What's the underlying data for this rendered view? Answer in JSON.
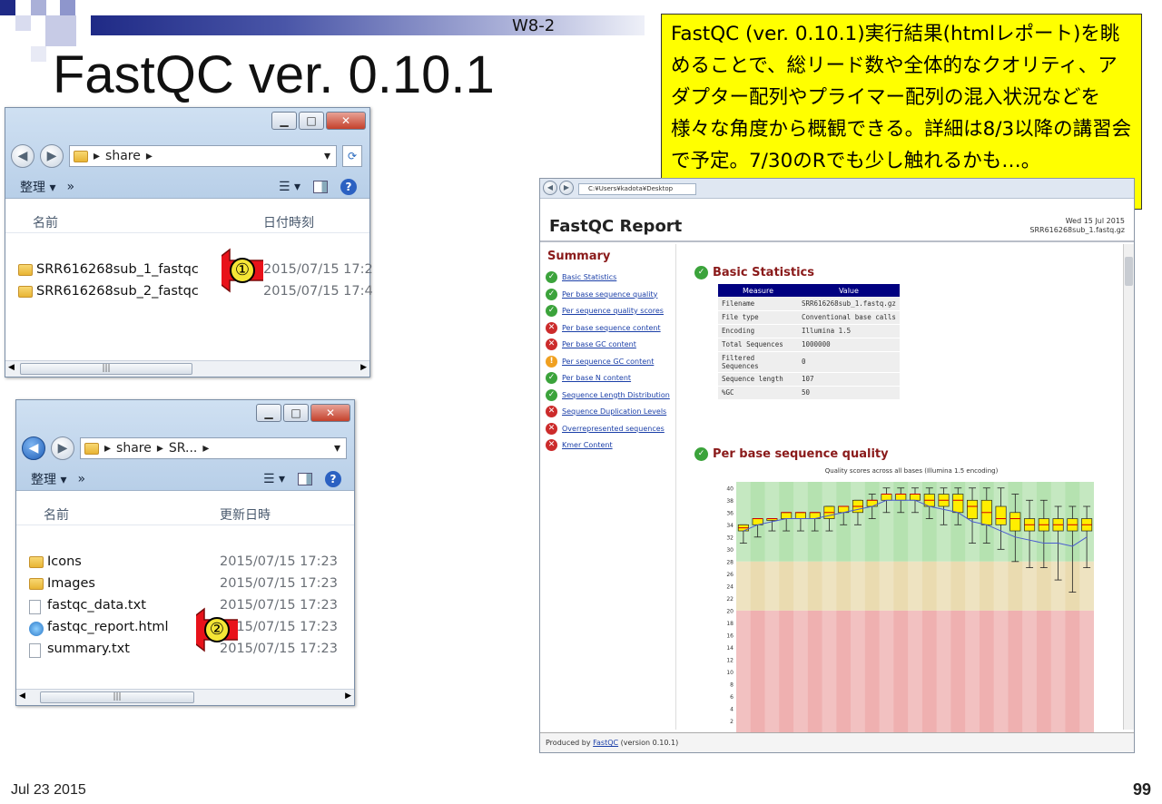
{
  "slide": {
    "code": "W8-2",
    "title": "FastQC ver. 0.10.1",
    "callout": "FastQC (ver. 0.10.1)実行結果(htmlレポート)を眺めることで、総リード数や全体的なクオリティ、アダプター配列やプライマー配列の混入状況などを様々な角度から概観できる。詳細は8/3以降の講習会で予定。7/30のRでも少し触れるかも…。",
    "date": "Jul 23 2015",
    "page": "99"
  },
  "explorer1": {
    "path": [
      "share"
    ],
    "organize_label": "整理 ▾",
    "more_label": "»",
    "col_name": "名前",
    "col_date": "日付時刻",
    "items": [
      {
        "name": "SRR616268sub_1_fastqc",
        "date": "2015/07/15 17:2",
        "icon": "folder-icon"
      },
      {
        "name": "SRR616268sub_2_fastqc",
        "date": "2015/07/15 17:4",
        "icon": "folder-icon"
      }
    ],
    "marker": "①"
  },
  "explorer2": {
    "path": [
      "share",
      "SR..."
    ],
    "organize_label": "整理 ▾",
    "more_label": "»",
    "col_name": "名前",
    "col_date": "更新日時",
    "items": [
      {
        "name": "Icons",
        "date": "2015/07/15 17:23",
        "icon": "folder-icon"
      },
      {
        "name": "Images",
        "date": "2015/07/15 17:23",
        "icon": "folder-icon"
      },
      {
        "name": "fastqc_data.txt",
        "date": "2015/07/15 17:23",
        "icon": "text-file-icon"
      },
      {
        "name": "fastqc_report.html",
        "date": "2015/07/15 17:23",
        "icon": "html-file-icon"
      },
      {
        "name": "summary.txt",
        "date": "2015/07/15 17:23",
        "icon": "text-file-icon"
      }
    ],
    "marker": "②"
  },
  "fastqc": {
    "url": "C:¥Users¥kadota¥Desktop",
    "report_title": "FastQC Report",
    "report_date": "Wed 15 Jul 2015",
    "report_file": "SRR616268sub_1.fastq.gz",
    "summary_heading": "Summary",
    "modules": [
      {
        "label": "Basic Statistics",
        "status": "pass"
      },
      {
        "label": "Per base sequence quality",
        "status": "pass"
      },
      {
        "label": "Per sequence quality scores",
        "status": "pass"
      },
      {
        "label": "Per base sequence content",
        "status": "fail"
      },
      {
        "label": "Per base GC content",
        "status": "fail"
      },
      {
        "label": "Per sequence GC content",
        "status": "warn"
      },
      {
        "label": "Per base N content",
        "status": "pass"
      },
      {
        "label": "Sequence Length Distribution",
        "status": "pass"
      },
      {
        "label": "Sequence Duplication Levels",
        "status": "fail"
      },
      {
        "label": "Overrepresented sequences",
        "status": "fail"
      },
      {
        "label": "Kmer Content",
        "status": "fail"
      }
    ],
    "basic_stats_heading": "Basic Statistics",
    "stats_header": [
      "Measure",
      "Value"
    ],
    "stats": [
      [
        "Filename",
        "SRR616268sub_1.fastq.gz"
      ],
      [
        "File type",
        "Conventional base calls"
      ],
      [
        "Encoding",
        "Illumina 1.5"
      ],
      [
        "Total Sequences",
        "1000000"
      ],
      [
        "Filtered Sequences",
        "0"
      ],
      [
        "Sequence length",
        "107"
      ],
      [
        "%GC",
        "50"
      ]
    ],
    "pbsq_heading": "Per base sequence quality",
    "plot_title": "Quality scores across all bases (Illumina 1.5 encoding)",
    "footer_prefix": "Produced by ",
    "footer_link": "FastQC",
    "footer_suffix": " (version 0.10.1)"
  },
  "chart_data": {
    "type": "box",
    "title": "Quality scores across all bases (Illumina 1.5 encoding)",
    "y_ticks": [
      2,
      4,
      6,
      8,
      10,
      12,
      14,
      16,
      18,
      20,
      22,
      24,
      26,
      28,
      30,
      32,
      34,
      36,
      38,
      40
    ],
    "ylim": [
      0,
      41
    ],
    "bands": {
      "good": [
        28,
        41
      ],
      "reasonable": [
        20,
        28
      ],
      "poor": [
        0,
        20
      ]
    },
    "boxes": [
      {
        "q1": 33,
        "q3": 34,
        "median": 33.5,
        "low": 31,
        "high": 34
      },
      {
        "q1": 34,
        "q3": 35,
        "median": 35,
        "low": 32,
        "high": 35
      },
      {
        "q1": 35,
        "q3": 35,
        "median": 35,
        "low": 33,
        "high": 35
      },
      {
        "q1": 35,
        "q3": 36,
        "median": 36,
        "low": 33,
        "high": 36
      },
      {
        "q1": 35,
        "q3": 36,
        "median": 36,
        "low": 33,
        "high": 36
      },
      {
        "q1": 35,
        "q3": 36,
        "median": 36,
        "low": 33,
        "high": 36
      },
      {
        "q1": 35,
        "q3": 37,
        "median": 36,
        "low": 33,
        "high": 37
      },
      {
        "q1": 36,
        "q3": 37,
        "median": 37,
        "low": 34,
        "high": 37
      },
      {
        "q1": 36,
        "q3": 38,
        "median": 37,
        "low": 34,
        "high": 38
      },
      {
        "q1": 37,
        "q3": 38,
        "median": 38,
        "low": 35,
        "high": 39
      },
      {
        "q1": 38,
        "q3": 39,
        "median": 39,
        "low": 36,
        "high": 40
      },
      {
        "q1": 38,
        "q3": 39,
        "median": 39,
        "low": 36,
        "high": 40
      },
      {
        "q1": 38,
        "q3": 39,
        "median": 39,
        "low": 36,
        "high": 40
      },
      {
        "q1": 37,
        "q3": 39,
        "median": 38,
        "low": 35,
        "high": 40
      },
      {
        "q1": 37,
        "q3": 39,
        "median": 38,
        "low": 34,
        "high": 40
      },
      {
        "q1": 36,
        "q3": 39,
        "median": 38,
        "low": 34,
        "high": 40
      },
      {
        "q1": 35,
        "q3": 38,
        "median": 37,
        "low": 31,
        "high": 40
      },
      {
        "q1": 34,
        "q3": 38,
        "median": 36,
        "low": 31,
        "high": 40
      },
      {
        "q1": 34,
        "q3": 37,
        "median": 35,
        "low": 30,
        "high": 40
      },
      {
        "q1": 33,
        "q3": 36,
        "median": 35,
        "low": 28,
        "high": 39
      },
      {
        "q1": 33,
        "q3": 35,
        "median": 34,
        "low": 27,
        "high": 38
      },
      {
        "q1": 33,
        "q3": 35,
        "median": 34,
        "low": 27,
        "high": 38
      },
      {
        "q1": 33,
        "q3": 35,
        "median": 34,
        "low": 25,
        "high": 37
      },
      {
        "q1": 33,
        "q3": 35,
        "median": 34,
        "low": 23,
        "high": 37
      },
      {
        "q1": 33,
        "q3": 35,
        "median": 34,
        "low": 27,
        "high": 37
      }
    ],
    "mean": [
      33,
      34,
      34.5,
      35,
      35,
      35,
      35.5,
      36,
      36.5,
      37,
      38,
      38,
      38,
      37,
      36.5,
      36,
      34.5,
      34,
      33,
      32,
      31.5,
      31,
      31,
      30.5,
      32
    ]
  }
}
